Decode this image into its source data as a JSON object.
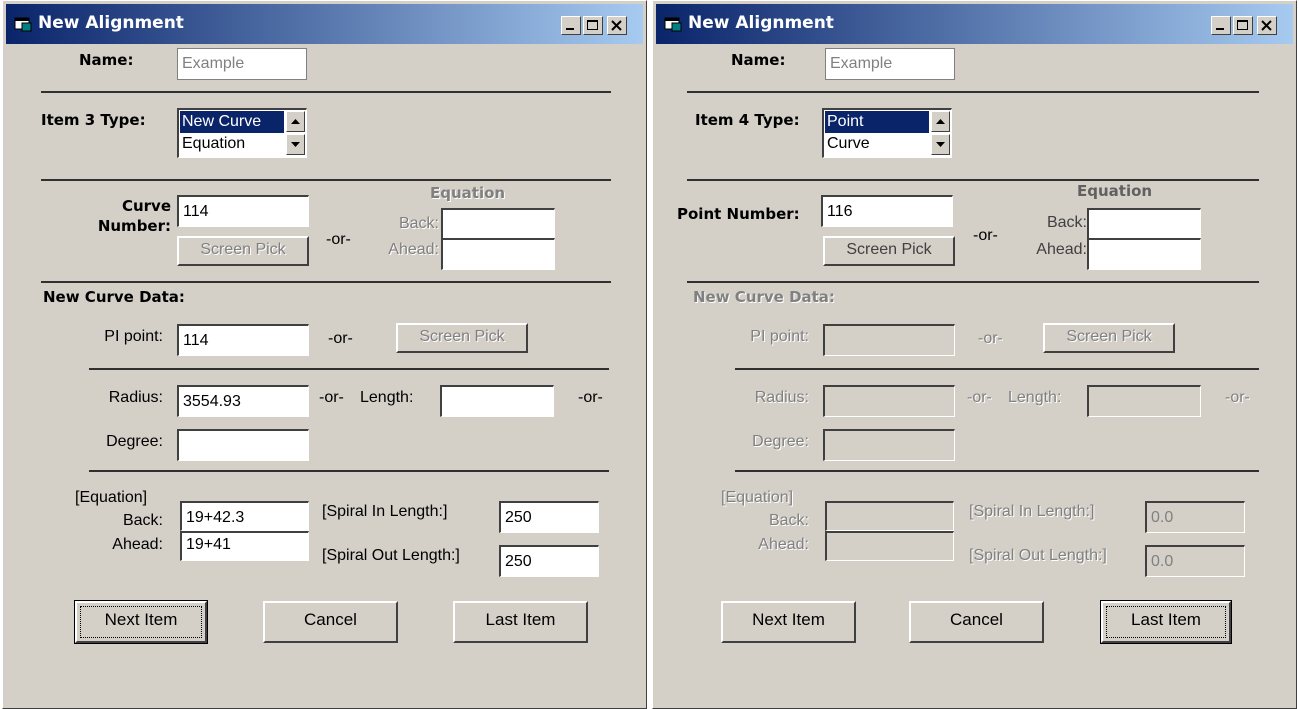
{
  "left": {
    "window_title": "New Alignment",
    "name_label": "Name:",
    "name_value": "Example",
    "item_type_label": "Item 3 Type:",
    "item_types": [
      "New Curve",
      "Equation"
    ],
    "selected_type": "New Curve",
    "number_label_line1": "Curve",
    "number_label_line2": "Number:",
    "number_value": "114",
    "screen_pick": "Screen Pick",
    "or": "-or-",
    "equation_heading": "Equation",
    "eq_back_label": "Back:",
    "eq_ahead_label": "Ahead:",
    "eq_back_value": "",
    "eq_ahead_value": "",
    "section_heading": "New Curve Data:",
    "pi_label": "PI point:",
    "pi_value": "114",
    "radius_label": "Radius:",
    "radius_value": "3554.93",
    "length_label": "Length:",
    "length_value": "",
    "degree_label": "Degree:",
    "degree_value": "",
    "equation_bracket": "[Equation]",
    "back_label": "Back:",
    "ahead_label": "Ahead:",
    "back_value": "19+42.3",
    "ahead_value": "19+41",
    "spiral_in_label": "[Spiral In Length:]",
    "spiral_in_value": "250",
    "spiral_out_label": "[Spiral Out Length:]",
    "spiral_out_value": "250",
    "next_item": "Next Item",
    "cancel": "Cancel",
    "last_item": "Last Item"
  },
  "right": {
    "window_title": "New Alignment",
    "name_label": "Name:",
    "name_value": "Example",
    "item_type_label": "Item 4 Type:",
    "item_types": [
      "Point",
      "Curve"
    ],
    "selected_type": "Point",
    "number_label": "Point Number:",
    "number_value": "116",
    "screen_pick": "Screen Pick",
    "or": "-or-",
    "equation_heading": "Equation",
    "eq_back_label": "Back:",
    "eq_ahead_label": "Ahead:",
    "eq_back_value": "",
    "eq_ahead_value": "",
    "section_heading": "New Curve Data:",
    "pi_label": "PI point:",
    "pi_value": "",
    "radius_label": "Radius:",
    "radius_value": "",
    "length_label": "Length:",
    "length_value": "",
    "degree_label": "Degree:",
    "degree_value": "",
    "equation_bracket": "[Equation]",
    "back_label": "Back:",
    "ahead_label": "Ahead:",
    "back_value": "",
    "ahead_value": "",
    "spiral_in_label": "[Spiral In Length:]",
    "spiral_in_value": "0.0",
    "spiral_out_label": "[Spiral Out Length:]",
    "spiral_out_value": "0.0",
    "next_item": "Next Item",
    "cancel": "Cancel",
    "last_item": "Last Item"
  },
  "colors": {
    "dialog_face": "#d4d0c8",
    "title_active_start": "#0a246a",
    "title_active_end": "#a6caf0",
    "selection": "#0a246a",
    "disabled_text": "#808080"
  },
  "icons": [
    "app-window-icon",
    "minimize-icon",
    "maximize-icon",
    "close-icon",
    "scroll-up-arrow-icon",
    "scroll-down-arrow-icon"
  ]
}
